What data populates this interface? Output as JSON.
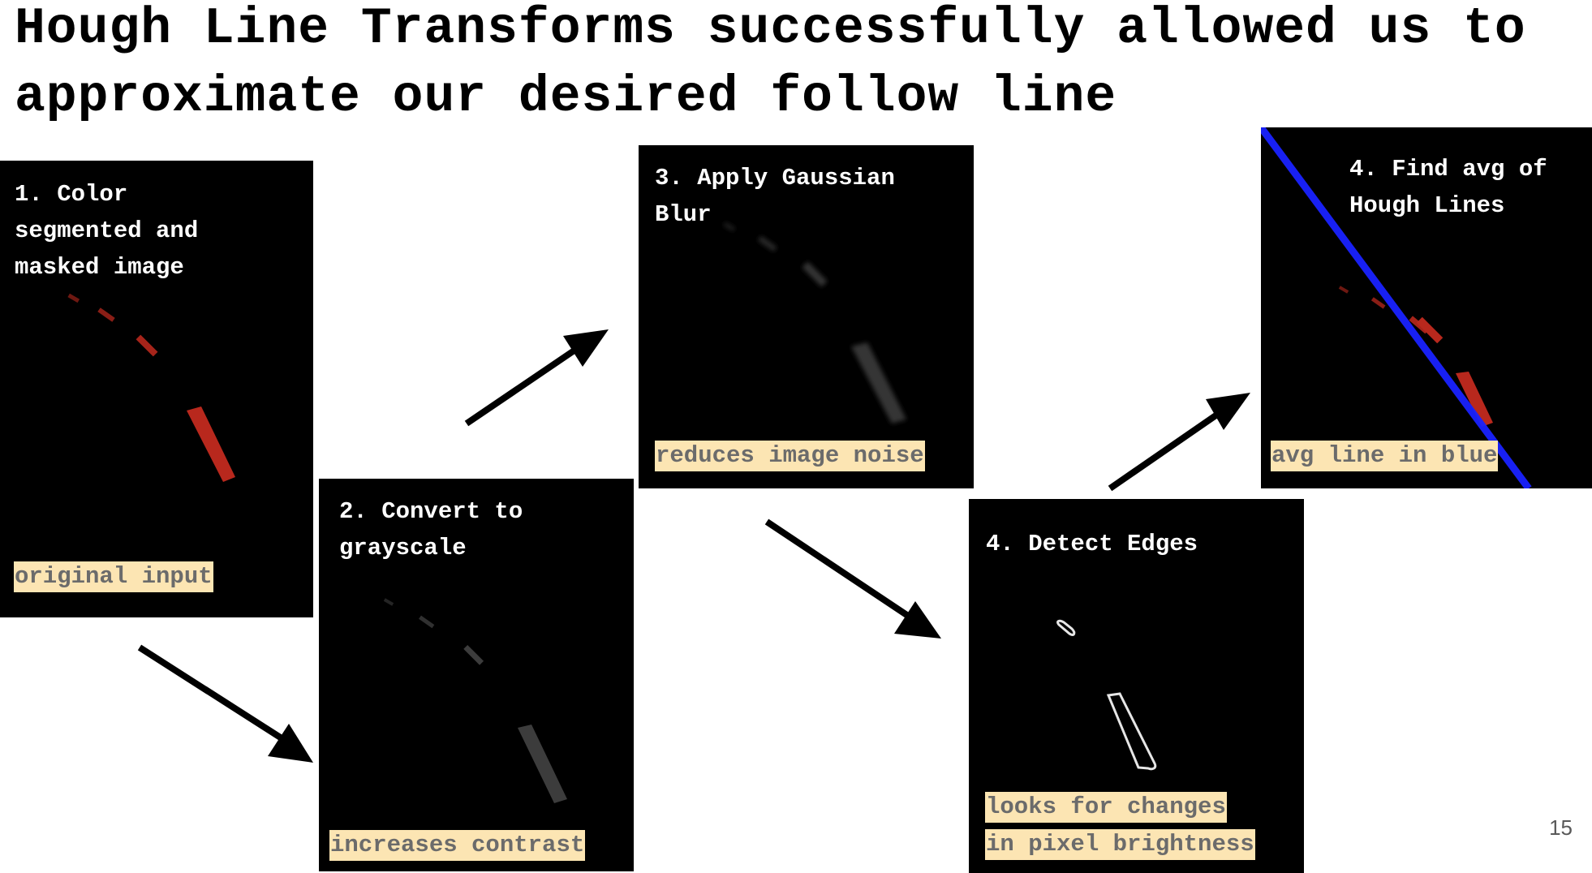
{
  "slide": {
    "title": "Hough Line Transforms successfully allowed us to approximate our desired follow line",
    "page_number": "15"
  },
  "panels": {
    "p1": {
      "step": "1. Color\nsegmented and\nmasked image",
      "caption": "original input"
    },
    "p2": {
      "step": "2. Convert to\ngrayscale",
      "caption": "increases contrast"
    },
    "p3": {
      "step": "3. Apply Gaussian\nBlur",
      "caption": "reduces image noise"
    },
    "p4": {
      "step": "4. Detect Edges",
      "caption_line1": "looks for changes",
      "caption_line2": "in pixel brightness"
    },
    "p5": {
      "step": "4. Find avg of\nHough Lines",
      "caption": "avg line in blue"
    }
  },
  "colors": {
    "caption_bg": "#fce5b3",
    "segment_red": "#b8281d",
    "avg_line_blue": "#1a22ff"
  }
}
